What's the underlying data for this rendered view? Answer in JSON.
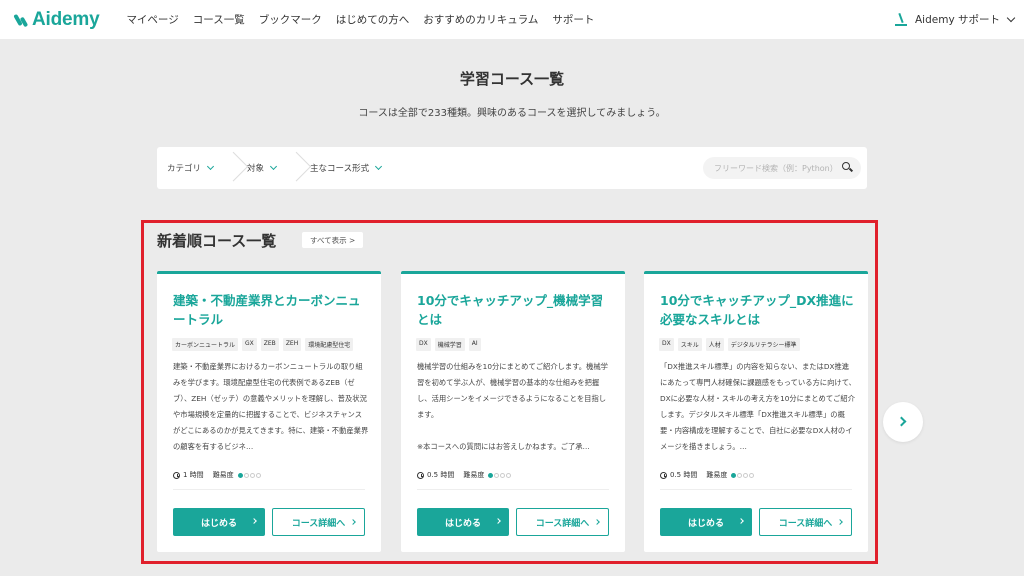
{
  "header": {
    "logo_text": "Aidemy",
    "nav": [
      "マイページ",
      "コース一覧",
      "ブックマーク",
      "はじめての方へ",
      "おすすめのカリキュラム",
      "サポート"
    ],
    "user_menu_label": "Aidemy サポート"
  },
  "page": {
    "title": "学習コース一覧",
    "subtitle": "コースは全部で233種類。興味のあるコースを選択してみましょう。"
  },
  "filters": {
    "items": [
      "カテゴリ",
      "対象",
      "主なコース形式"
    ],
    "search_placeholder": "フリーワード検索（例：Python）"
  },
  "section": {
    "title": "新着順コース一覧",
    "see_all_label": "すべて表示 >"
  },
  "cards": [
    {
      "title": "建築・不動産業界とカーボンニュートラル",
      "tags": [
        "カーボンニュートラル",
        "GX",
        "ZEB",
        "ZEH",
        "環境配慮型住宅"
      ],
      "description": "建築・不動産業界におけるカーボンニュートラルの取り組みを学びます。環境配慮型住宅の代表例であるZEB（ゼブ）、ZEH（ゼッチ）の意義やメリットを理解し、普及状況や市場規模を定量的に把握することで、ビジネスチャンスがどこにあるのかが見えてきます。特に、建築・不動産業界の顧客を有するビジネ…",
      "duration": "1 時間",
      "difficulty_label": "難易度",
      "difficulty": 1,
      "difficulty_max": 4,
      "start_label": "はじめる",
      "detail_label": "コース詳細へ"
    },
    {
      "title": "10分でキャッチアップ_機械学習とは",
      "tags": [
        "DX",
        "機械学習",
        "AI"
      ],
      "description": "機械学習の仕組みを10分にまとめてご紹介します。機械学習を初めて学ぶ人が、機械学習の基本的な仕組みを把握し、活用シーンをイメージできるようになることを目指します。\n\n※本コースへの質問にはお答えしかねます。ご了承…",
      "duration": "0.5 時間",
      "difficulty_label": "難易度",
      "difficulty": 1,
      "difficulty_max": 4,
      "start_label": "はじめる",
      "detail_label": "コース詳細へ"
    },
    {
      "title": "10分でキャッチアップ_DX推進に必要なスキルとは",
      "tags": [
        "DX",
        "スキル",
        "人材",
        "デジタルリテラシー標準"
      ],
      "description": "「DX推進スキル標準」の内容を知らない、またはDX推進にあたって専門人材確保に課題感をもっている方に向けて、DXに必要な人材・スキルの考え方を10分にまとめてご紹介します。デジタルスキル標準「DX推進スキル標準」の概要・内容構成を理解することで、自社に必要なDX人材のイメージを描きましょう。…",
      "duration": "0.5 時間",
      "difficulty_label": "難易度",
      "difficulty": 1,
      "difficulty_max": 4,
      "start_label": "はじめる",
      "detail_label": "コース詳細へ"
    }
  ],
  "colors": {
    "accent": "#1aa69a",
    "highlight_border": "#e0202c",
    "background": "#ebebeb"
  }
}
